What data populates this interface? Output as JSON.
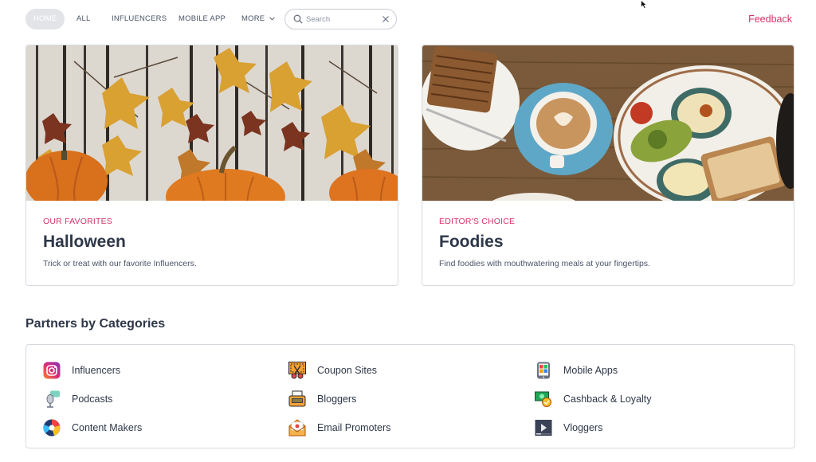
{
  "nav": {
    "tabs": [
      {
        "label": "HOME",
        "active": true
      },
      {
        "label": "ALL"
      },
      {
        "label": "INFLUENCERS"
      },
      {
        "label": "MOBILE APP"
      },
      {
        "label": "MORE"
      }
    ],
    "search_placeholder": "Search",
    "search_value": "",
    "feedback": "Feedback"
  },
  "cards": [
    {
      "kicker": "OUR FAVORITES",
      "title": "Halloween",
      "desc": "Trick or treat with our favorite Influencers."
    },
    {
      "kicker": "EDITOR'S CHOICE",
      "title": "Foodies",
      "desc": "Find foodies with mouthwatering meals at your fingertips."
    }
  ],
  "categories": {
    "title": "Partners by Categories",
    "items": [
      {
        "label": "Influencers",
        "icon": "instagram-icon"
      },
      {
        "label": "Coupon Sites",
        "icon": "scissors-coupon-icon"
      },
      {
        "label": "Mobile Apps",
        "icon": "mobile-apps-icon"
      },
      {
        "label": "Podcasts",
        "icon": "microphone-icon"
      },
      {
        "label": "Bloggers",
        "icon": "typewriter-icon"
      },
      {
        "label": "Cashback & Loyalty",
        "icon": "cashback-icon"
      },
      {
        "label": "Content Makers",
        "icon": "content-maker-icon"
      },
      {
        "label": "Email Promoters",
        "icon": "envelope-icon"
      },
      {
        "label": "Vloggers",
        "icon": "video-player-icon"
      }
    ]
  },
  "colors": {
    "accent": "#d6336c",
    "text": "#2d3748",
    "border": "#d5d9de"
  }
}
